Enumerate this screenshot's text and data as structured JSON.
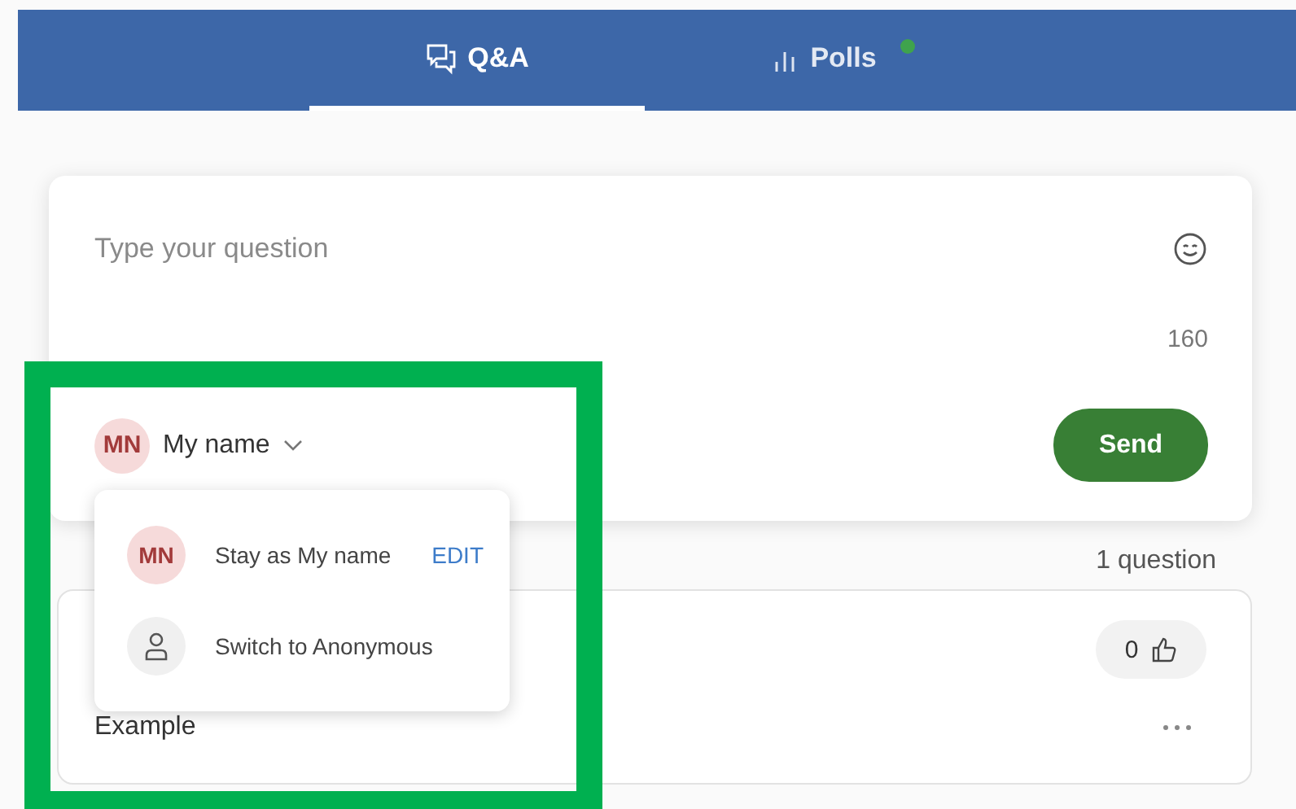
{
  "tabs": [
    {
      "label": "Q&A",
      "kind": "chat",
      "selected": true,
      "badge": false
    },
    {
      "label": "Polls",
      "kind": "poll",
      "selected": false,
      "badge": true
    }
  ],
  "composer": {
    "placeholder": "Type your question",
    "remaining": "160",
    "author": {
      "initials": "MN",
      "name": "My name"
    },
    "send": "Send"
  },
  "identity_menu": {
    "items": [
      {
        "kind": "named",
        "avatar": "MN",
        "label": "Stay as My name",
        "action": "EDIT"
      },
      {
        "kind": "anonymous",
        "label": "Switch to Anonymous"
      }
    ]
  },
  "question_count": "1 question",
  "questions": [
    {
      "text": "Example",
      "votes": "0"
    }
  ],
  "highlight": true
}
